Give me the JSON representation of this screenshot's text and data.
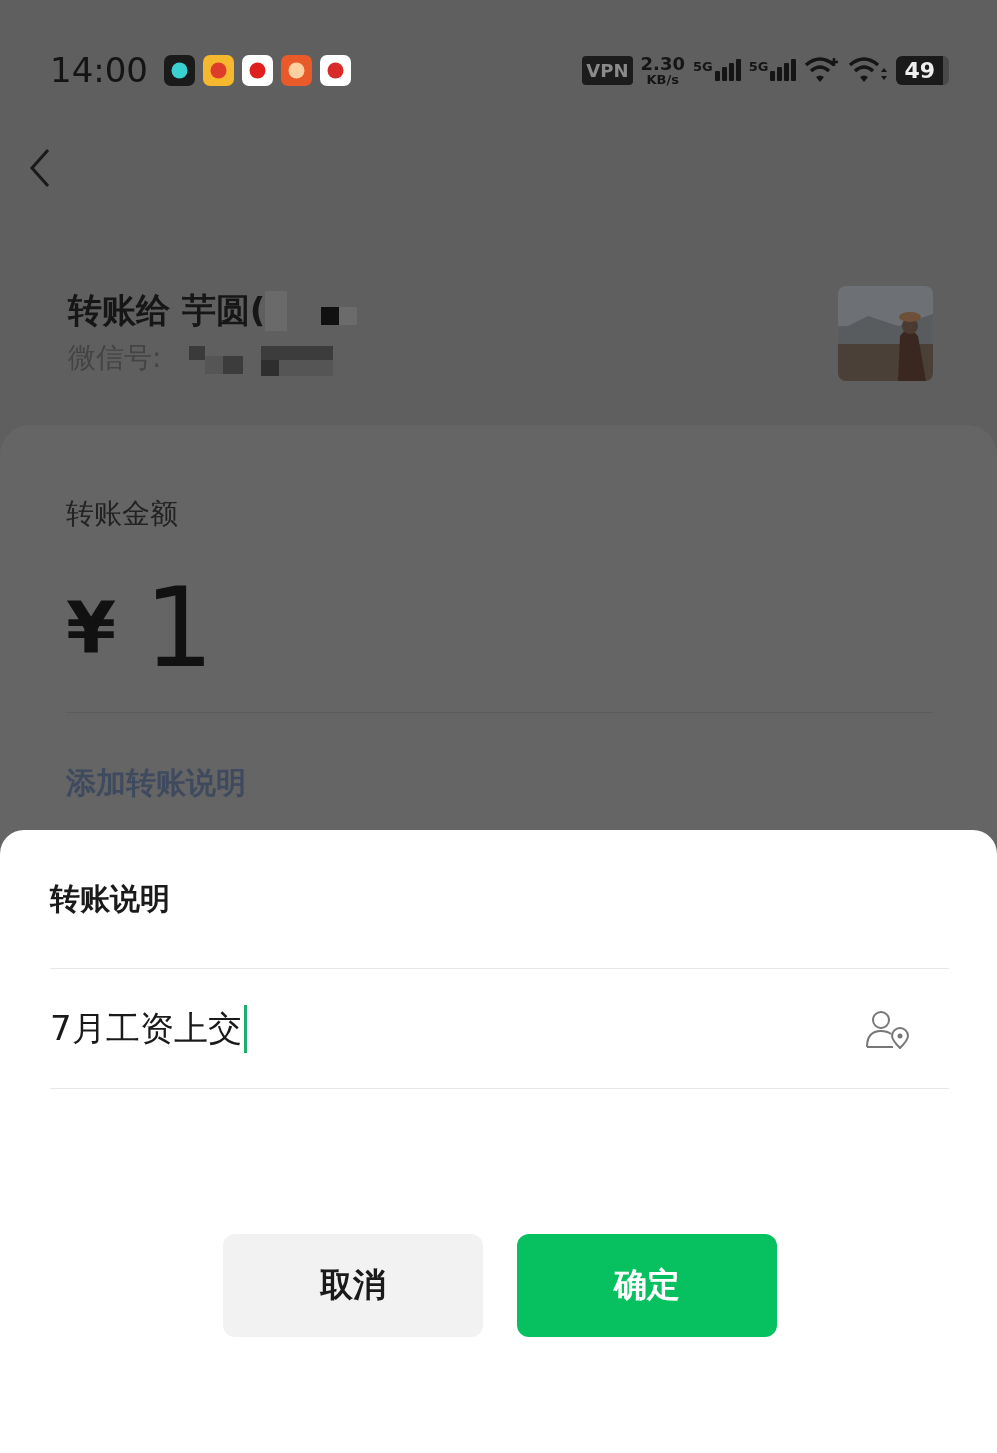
{
  "status_bar": {
    "time": "14:00",
    "vpn": "VPN",
    "speed": "2.30",
    "speed_unit": "KB/s",
    "signals": [
      "5G",
      "5G"
    ],
    "battery": "49"
  },
  "recipient": {
    "title": "转账给 芋圆(",
    "wechat_id": "微信号:"
  },
  "amount_card": {
    "label": "转账金额",
    "currency": "¥",
    "amount": "1",
    "add_note_link": "添加转账说明"
  },
  "note_sheet": {
    "title": "转账说明",
    "note_field": {
      "value": "7月工资上交"
    },
    "buttons": [
      {
        "label": "取消",
        "kind": "secondary"
      },
      {
        "label": "确定",
        "kind": "primary"
      }
    ]
  }
}
